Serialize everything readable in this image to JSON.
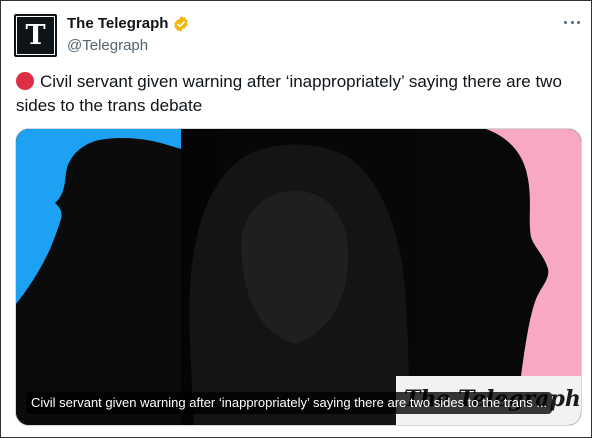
{
  "tweet": {
    "display_name": "The Telegraph",
    "handle": "@Telegraph",
    "avatar_letter": "T",
    "text": "Civil servant given warning after ‘inappropriately’ saying there are two sides to the trans debate",
    "leading_emoji": "red-circle",
    "verified_badge_color": "#f4b400",
    "more_icon": "more-horizontal-icon"
  },
  "media": {
    "caption": "Civil servant given warning after ‘inappropriately’ saying there are two sides to the trans ...",
    "wordmark": "The Telegraph",
    "panel_colors": [
      "#1da1f2",
      "#f8a9c1"
    ]
  }
}
